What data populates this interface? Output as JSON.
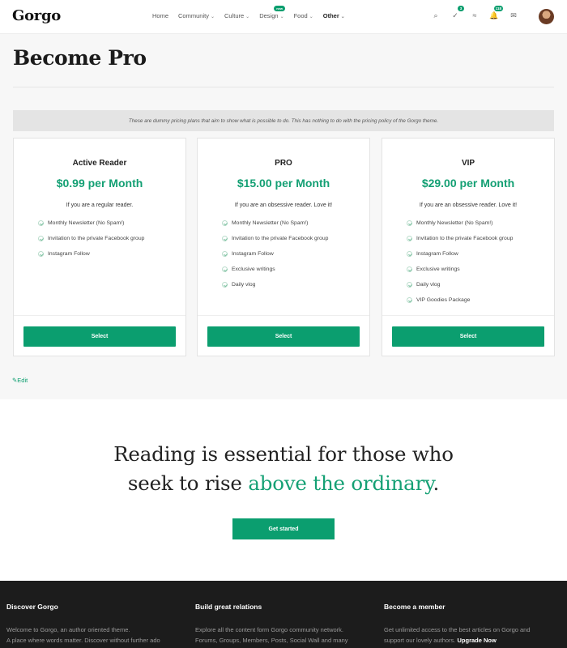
{
  "header": {
    "logo": "Gorgo",
    "nav": [
      {
        "label": "Home",
        "chevron": false
      },
      {
        "label": "Community",
        "chevron": true
      },
      {
        "label": "Culture",
        "chevron": true
      },
      {
        "label": "Design",
        "chevron": true,
        "badge": "new"
      },
      {
        "label": "Food",
        "chevron": true
      },
      {
        "label": "Other",
        "chevron": true
      }
    ],
    "icons": [
      {
        "name": "search-icon",
        "glyph": "⌕",
        "badge": null
      },
      {
        "name": "check-icon",
        "glyph": "✓",
        "badge": "3"
      },
      {
        "name": "users-icon",
        "glyph": "≈",
        "badge": null
      },
      {
        "name": "bell-icon",
        "glyph": "🔔",
        "badge": "118"
      },
      {
        "name": "mail-icon",
        "glyph": "✉",
        "badge": null
      }
    ]
  },
  "page": {
    "title": "Become Pro",
    "notice": "These are dummy pricing plans that aim to show what is possible to do. This has nothing to do with the pricing policy of the Gorgo theme.",
    "edit_label": "Edit"
  },
  "plans": [
    {
      "name": "Active Reader",
      "price": "$0.99 per Month",
      "description": "If you are a regular reader.",
      "features": [
        "Monthly Newsletter (No Spam!)",
        "Invitation to the private Facebook group",
        "Instagram Follow"
      ],
      "button": "Select"
    },
    {
      "name": "PRO",
      "price": "$15.00 per Month",
      "description": "If you are an obsessive reader. Love it!",
      "features": [
        "Monthly Newsletter (No Spam!)",
        "Invitation to the private Facebook group",
        "Instagram Follow",
        "Exclusive writings",
        "Daily vlog"
      ],
      "button": "Select"
    },
    {
      "name": "VIP",
      "price": "$29.00 per Month",
      "description": "If you are an obsessive reader. Love it!",
      "features": [
        "Monthly Newsletter (No Spam!)",
        "Invitation to the private Facebook group",
        "Instagram Follow",
        "Exclusive writings",
        "Daily vlog",
        "VIP Goodies Package"
      ],
      "button": "Select"
    }
  ],
  "cta": {
    "line1": "Reading is essential for those who",
    "line2_prefix": "seek to rise ",
    "line2_accent": "above the ordinary",
    "line2_suffix": ".",
    "button": "Get started"
  },
  "footer": {
    "columns": [
      {
        "title": "Discover Gorgo",
        "lines": [
          "Welcome to Gorgo, an author oriented theme.",
          "A place where words matter. Discover without further ado"
        ]
      },
      {
        "title": "Build great relations",
        "lines": [
          "Explore all the content form Gorgo community network.",
          "Forums, Groups, Members, Posts, Social Wall and many"
        ]
      },
      {
        "title": "Become a member",
        "lines": [
          "Get unlimited access to the best articles on Gorgo and",
          "support our  lovely authors."
        ],
        "link": "Upgrade Now"
      }
    ]
  },
  "colors": {
    "accent": "#0b9e6f",
    "footer_bg": "#1c1c1c"
  }
}
